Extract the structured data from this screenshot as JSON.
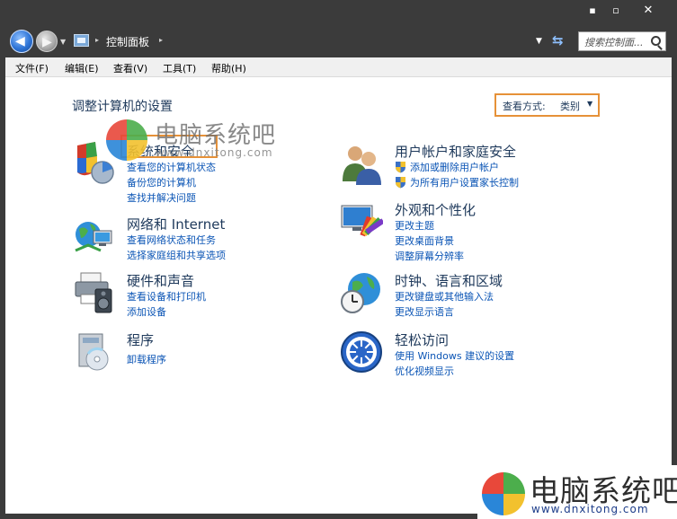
{
  "window": {
    "controls": {
      "minimize": "▪",
      "maximize": "▫",
      "close": "✕"
    }
  },
  "navbar": {
    "breadcrumb": "控制面板",
    "search_placeholder": "搜索控制面..."
  },
  "menubar": {
    "items": [
      "文件(F)",
      "编辑(E)",
      "查看(V)",
      "工具(T)",
      "帮助(H)"
    ]
  },
  "page": {
    "title": "调整计算机的设置",
    "view_by_label": "查看方式:",
    "view_by_value": "类别"
  },
  "categories": [
    {
      "title": "系统和安全",
      "icon": "system-security-icon",
      "links": [
        "查看您的计算机状态",
        "备份您的计算机",
        "查找并解决问题"
      ]
    },
    {
      "title": "网络和 Internet",
      "icon": "network-icon",
      "links": [
        "查看网络状态和任务",
        "选择家庭组和共享选项"
      ]
    },
    {
      "title": "硬件和声音",
      "icon": "hardware-sound-icon",
      "links": [
        "查看设备和打印机",
        "添加设备"
      ]
    },
    {
      "title": "程序",
      "icon": "programs-icon",
      "links": [
        "卸载程序"
      ]
    },
    {
      "title": "用户帐户和家庭安全",
      "icon": "user-accounts-icon",
      "links": [
        "添加或删除用户帐户",
        "为所有用户设置家长控制"
      ]
    },
    {
      "title": "外观和个性化",
      "icon": "appearance-icon",
      "links": [
        "更改主题",
        "更改桌面背景",
        "调整屏幕分辨率"
      ]
    },
    {
      "title": "时钟、语言和区域",
      "icon": "clock-language-icon",
      "links": [
        "更改键盘或其他输入法",
        "更改显示语言"
      ]
    },
    {
      "title": "轻松访问",
      "icon": "ease-of-access-icon",
      "links": [
        "使用 Windows 建议的设置",
        "优化视频显示"
      ]
    }
  ],
  "watermark": {
    "text": "电脑系统吧",
    "url": "www.dnxitong.com"
  },
  "colors": {
    "accent_orange": "#e69138",
    "link_blue": "#0a54b5",
    "title_navy": "#1e395b",
    "chrome_dark": "#3b3b3b"
  }
}
